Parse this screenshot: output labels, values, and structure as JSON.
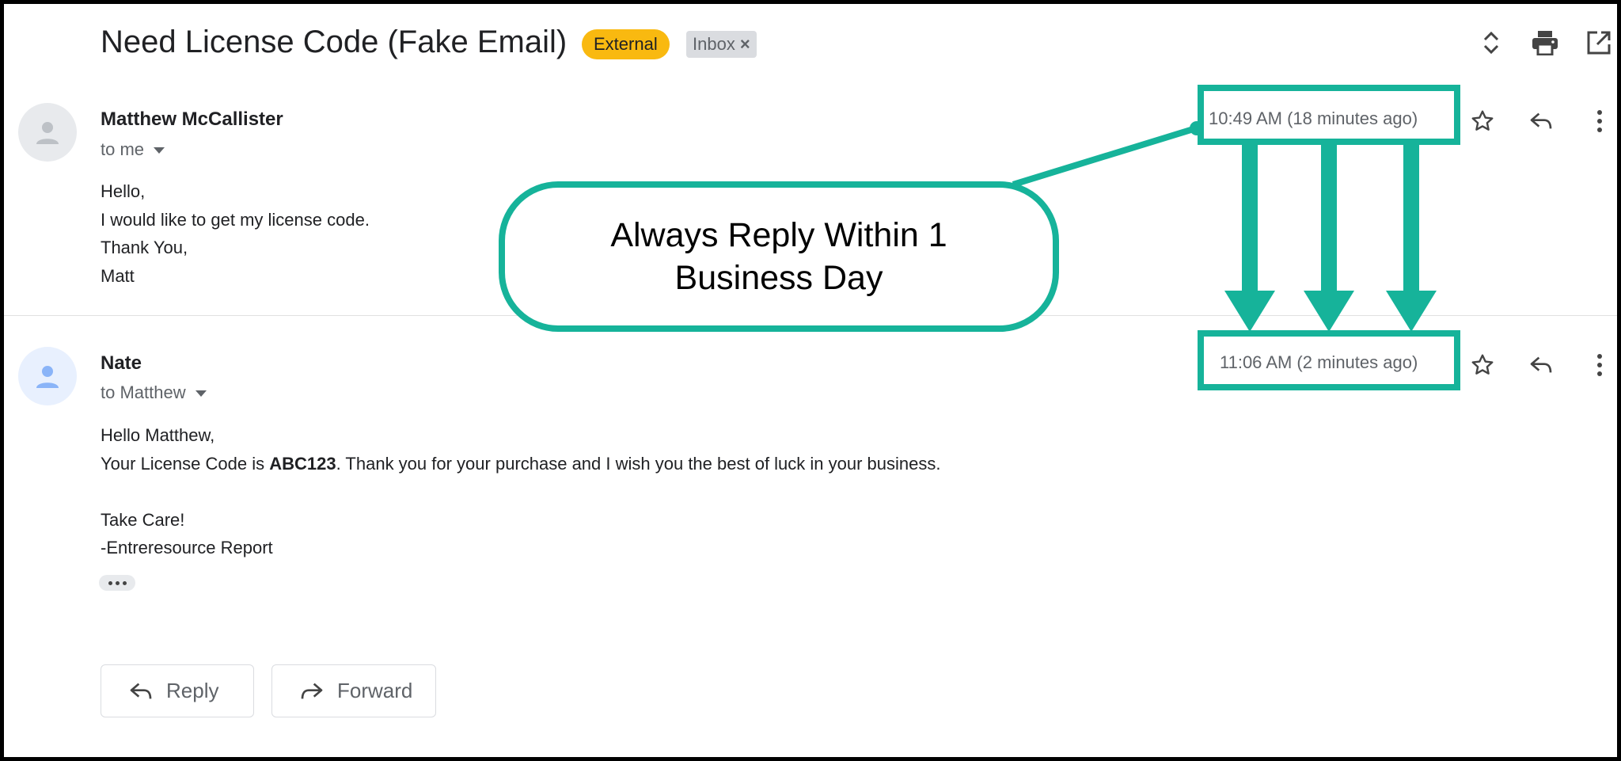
{
  "subject": "Need License Code (Fake Email)",
  "labels": {
    "external": "External",
    "inbox": "Inbox",
    "remove": "×"
  },
  "toolbar": {
    "expand_icon": "expand-collapse-icon",
    "print_icon": "print-icon",
    "popout_icon": "open-in-new-window-icon"
  },
  "messages": [
    {
      "sender": "Matthew McCallister",
      "recipient": "to me",
      "time": "10:49 AM (18 minutes ago)",
      "body": [
        "Hello,",
        "I would like to get my license code.",
        "Thank You,",
        "Matt"
      ]
    },
    {
      "sender": "Nate",
      "recipient": "to Matthew",
      "time": "11:06 AM (2 minutes ago)",
      "body_intro": "Hello Matthew,",
      "body_line2_pre": "Your License Code is ",
      "body_line2_code": "ABC123",
      "body_line2_post": ". Thank you for your purchase and I wish you the best of luck in your business.",
      "body_signoff": "Take Care!",
      "body_signature": "-Entreresource Report"
    }
  ],
  "actions": {
    "reply": "Reply",
    "forward": "Forward"
  },
  "annotation": {
    "callout_line1": "Always Reply Within 1",
    "callout_line2": "Business Day",
    "color": "#16b39a"
  },
  "colors": {
    "external_label": "#f9b910",
    "inbox_label": "#dadce0",
    "annotation": "#16b39a"
  }
}
